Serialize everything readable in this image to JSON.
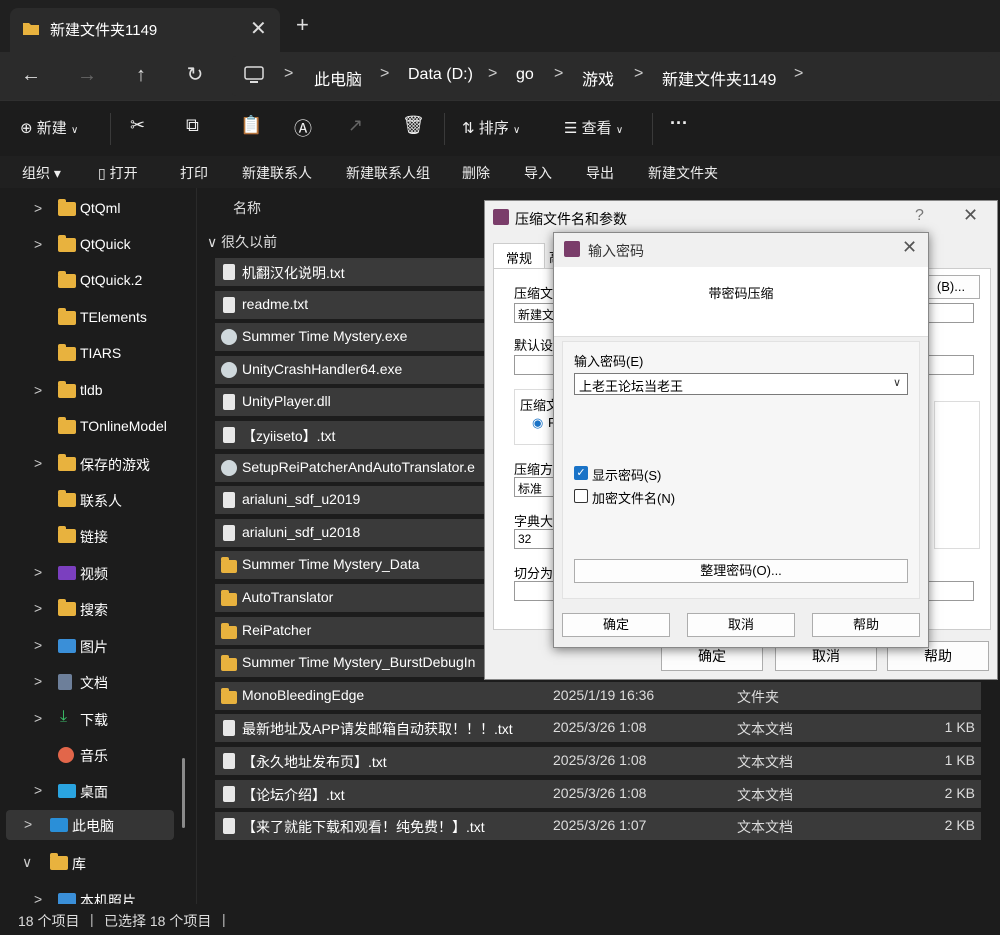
{
  "window": {
    "tab_title": "新建文件夹1149",
    "close_glyph": "✕",
    "newtab_glyph": "+"
  },
  "nav": {
    "back": "←",
    "forward": "→",
    "up": "↑",
    "refresh": "↻",
    "breadcrumbs": [
      "此电脑",
      "Data (D:)",
      "go",
      "游戏",
      "新建文件夹1149"
    ]
  },
  "toolbar": {
    "new_label": "新建",
    "sort_label": "排序",
    "view_label": "查看",
    "more_glyph": "···"
  },
  "menu": [
    "组织 ▾",
    "打开",
    "打印",
    "新建联系人",
    "新建联系人组",
    "删除",
    "导入",
    "导出",
    "新建文件夹"
  ],
  "sidebar": {
    "items": [
      {
        "label": "QtQml",
        "arrow": ">",
        "icon": "folder-icon"
      },
      {
        "label": "QtQuick",
        "arrow": ">",
        "icon": "folder-icon"
      },
      {
        "label": "QtQuick.2",
        "arrow": "",
        "icon": "folder-icon"
      },
      {
        "label": "TElements",
        "arrow": "",
        "icon": "folder-icon"
      },
      {
        "label": "TIARS",
        "arrow": "",
        "icon": "folder-icon"
      },
      {
        "label": "tldb",
        "arrow": ">",
        "icon": "folder-icon"
      },
      {
        "label": "TOnlineModel",
        "arrow": "",
        "icon": "folder-icon"
      },
      {
        "label": "保存的游戏",
        "arrow": ">",
        "icon": "folder-icon"
      },
      {
        "label": "联系人",
        "arrow": "",
        "icon": "folder-icon"
      },
      {
        "label": "链接",
        "arrow": "",
        "icon": "folder-icon"
      },
      {
        "label": "视频",
        "arrow": ">",
        "icon": "video-icon"
      },
      {
        "label": "搜索",
        "arrow": ">",
        "icon": "folder-icon"
      },
      {
        "label": "图片",
        "arrow": ">",
        "icon": "picture-icon"
      },
      {
        "label": "文档",
        "arrow": ">",
        "icon": "document-icon"
      },
      {
        "label": "下载",
        "arrow": ">",
        "icon": "download-icon"
      },
      {
        "label": "音乐",
        "arrow": "",
        "icon": "music-icon"
      },
      {
        "label": "桌面",
        "arrow": ">",
        "icon": "desktop-icon"
      },
      {
        "label": "此电脑",
        "arrow": ">",
        "icon": "pc-icon"
      },
      {
        "label": "库",
        "arrow": "∨",
        "icon": "folder-icon"
      },
      {
        "label": "本机照片",
        "arrow": ">",
        "icon": "picture-icon"
      }
    ]
  },
  "list": {
    "column_name": "名称",
    "group_label": "∨ 很久以前",
    "rows": [
      {
        "name": "机翻汉化说明.txt",
        "date": "",
        "type": "",
        "size": "",
        "icon": "file"
      },
      {
        "name": "readme.txt",
        "date": "",
        "type": "",
        "size": "",
        "icon": "file"
      },
      {
        "name": "Summer Time Mystery.exe",
        "date": "",
        "type": "",
        "size": "",
        "icon": "exe"
      },
      {
        "name": "UnityCrashHandler64.exe",
        "date": "",
        "type": "",
        "size": "",
        "icon": "exe"
      },
      {
        "name": "UnityPlayer.dll",
        "date": "",
        "type": "",
        "size": "",
        "icon": "file"
      },
      {
        "name": "【zyiiseto】.txt",
        "date": "",
        "type": "",
        "size": "",
        "icon": "file"
      },
      {
        "name": "SetupReiPatcherAndAutoTranslator.e",
        "date": "",
        "type": "",
        "size": "",
        "icon": "exe"
      },
      {
        "name": "arialuni_sdf_u2019",
        "date": "",
        "type": "",
        "size": "",
        "icon": "file"
      },
      {
        "name": "arialuni_sdf_u2018",
        "date": "",
        "type": "",
        "size": "",
        "icon": "file"
      },
      {
        "name": "Summer Time Mystery_Data",
        "date": "",
        "type": "",
        "size": "",
        "icon": "folder"
      },
      {
        "name": "AutoTranslator",
        "date": "",
        "type": "",
        "size": "",
        "icon": "folder"
      },
      {
        "name": "ReiPatcher",
        "date": "",
        "type": "",
        "size": "",
        "icon": "folder"
      },
      {
        "name": "Summer Time Mystery_BurstDebugIn",
        "date": "",
        "type": "",
        "size": "",
        "icon": "folder"
      },
      {
        "name": "MonoBleedingEdge",
        "date": "2025/1/19 16:36",
        "type": "文件夹",
        "size": "",
        "icon": "folder"
      },
      {
        "name": "最新地址及APP请发邮箱自动获取！！！.txt",
        "date": "2025/3/26 1:08",
        "type": "文本文档",
        "size": "1 KB",
        "icon": "file"
      },
      {
        "name": "【永久地址发布页】.txt",
        "date": "2025/3/26 1:08",
        "type": "文本文档",
        "size": "1 KB",
        "icon": "file"
      },
      {
        "name": "【论坛介绍】.txt",
        "date": "2025/3/26 1:08",
        "type": "文本文档",
        "size": "2 KB",
        "icon": "file"
      },
      {
        "name": "【来了就能下载和观看！纯免费！】.txt",
        "date": "2025/3/26 1:07",
        "type": "文本文档",
        "size": "2 KB",
        "icon": "file"
      }
    ]
  },
  "status": {
    "count": "18 个项目",
    "selected": "已选择 18 个项目"
  },
  "rar_dialog": {
    "title": "压缩文件名和参数",
    "help_glyph": "?",
    "close_glyph": "✕",
    "tab_general": "常规",
    "tab_second": "高",
    "archive_name_label": "压缩文",
    "archive_name_value": "新建文",
    "browse_label": "(B)...",
    "default_label": "默认设置",
    "format_label": "压缩文",
    "radio_label": "R",
    "method_label": "压缩方",
    "method_value": "标准",
    "dict_label": "字典大小",
    "dict_value": "32",
    "split_label": "切分为分",
    "ok": "确定",
    "cancel": "取消",
    "help": "帮助"
  },
  "pwd_dialog": {
    "title": "输入密码",
    "close_glyph": "✕",
    "header": "带密码压缩",
    "enter_label": "输入密码(E)",
    "password_value": "上老王论坛当老王",
    "show_password": "显示密码(S)",
    "show_password_checked": true,
    "encrypt_names": "加密文件名(N)",
    "encrypt_names_checked": false,
    "organize": "整理密码(O)...",
    "ok": "确定",
    "cancel": "取消",
    "help": "帮助"
  }
}
